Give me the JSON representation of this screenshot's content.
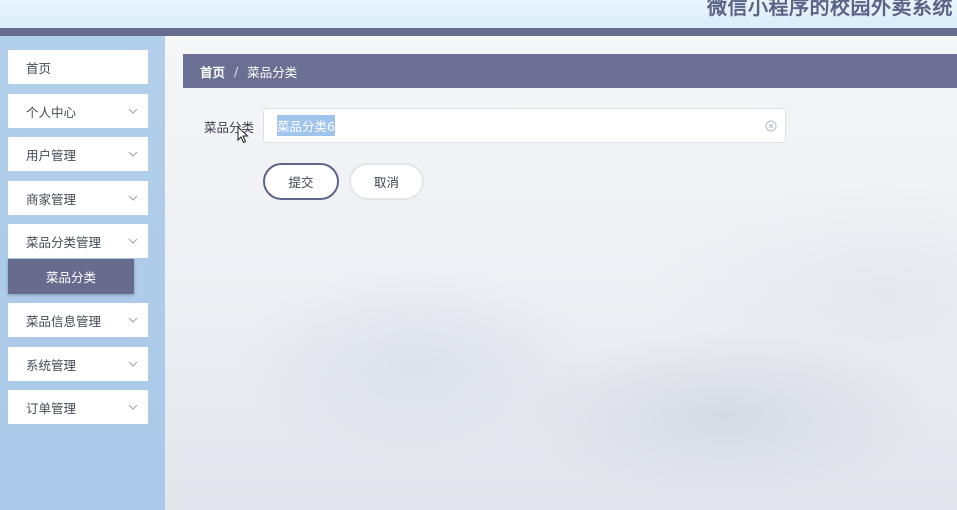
{
  "header": {
    "title": "微信小程序的校园外卖系统"
  },
  "sidebar": {
    "items": [
      {
        "label": "首页",
        "icon": null
      },
      {
        "label": "个人中心",
        "icon": "chevron-down-icon"
      },
      {
        "label": "用户管理",
        "icon": "chevron-down-icon"
      },
      {
        "label": "商家管理",
        "icon": "chevron-down-icon"
      },
      {
        "label": "菜品分类管理",
        "icon": "chevron-down-icon",
        "expanded": true,
        "submenu": [
          {
            "label": "菜品分类",
            "active": true
          }
        ]
      },
      {
        "label": "菜品信息管理",
        "icon": "chevron-down-icon"
      },
      {
        "label": "系统管理",
        "icon": "chevron-down-icon"
      },
      {
        "label": "订单管理",
        "icon": "chevron-down-icon"
      }
    ]
  },
  "breadcrumb": {
    "home": "首页",
    "separator": "/",
    "current": "菜品分类"
  },
  "form": {
    "field_label": "菜品分类",
    "field_value": "菜品分类6",
    "value_selected": true,
    "clear_icon": "circle-close-icon"
  },
  "buttons": {
    "submit": "提交",
    "cancel": "取消"
  },
  "colors": {
    "accent": "#6b6f94",
    "header_bar": "#676c8f",
    "sidebar_bg": "#aecbe9",
    "header_bg": "#e3f1fb",
    "text_selection": "#9fc4ee",
    "title_text": "#5d6386"
  }
}
